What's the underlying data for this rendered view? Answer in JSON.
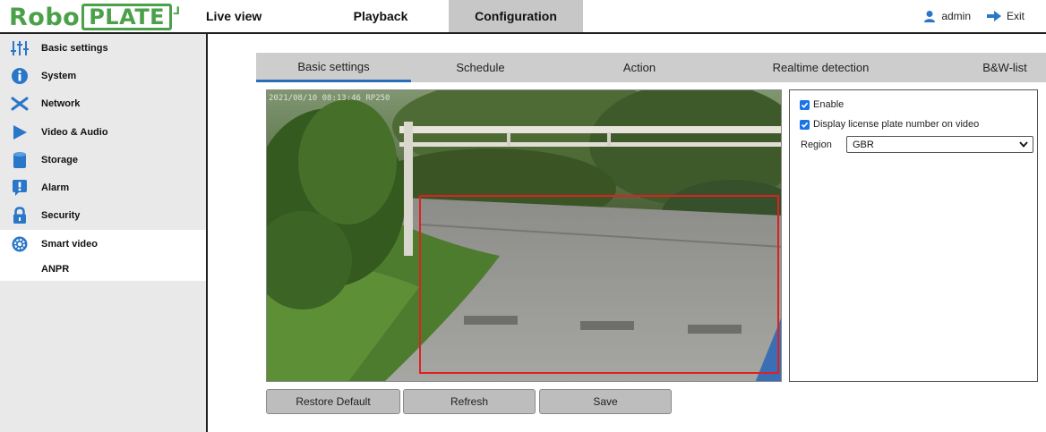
{
  "brand": {
    "robo": "Robo",
    "plate": "PLATE"
  },
  "topnav": {
    "tabs": [
      {
        "label": "Live view"
      },
      {
        "label": "Playback"
      },
      {
        "label": "Configuration"
      }
    ],
    "user": "admin",
    "exit": "Exit"
  },
  "sidebar": {
    "items": [
      {
        "label": "Basic settings",
        "icon": "sliders-icon"
      },
      {
        "label": "System",
        "icon": "info-icon"
      },
      {
        "label": "Network",
        "icon": "network-icon"
      },
      {
        "label": "Video & Audio",
        "icon": "play-icon"
      },
      {
        "label": "Storage",
        "icon": "storage-icon"
      },
      {
        "label": "Alarm",
        "icon": "alarm-icon"
      },
      {
        "label": "Security",
        "icon": "lock-icon"
      },
      {
        "label": "Smart video",
        "icon": "gear-icon"
      }
    ],
    "sub_items": [
      {
        "label": "ANPR"
      }
    ]
  },
  "subtabs": [
    {
      "label": "Basic settings"
    },
    {
      "label": "Schedule"
    },
    {
      "label": "Action"
    },
    {
      "label": "Realtime detection"
    },
    {
      "label": "B&W-list"
    }
  ],
  "video": {
    "overlay_text": "2021/08/10 08:13:46      RP250"
  },
  "settings": {
    "enable_label": "Enable",
    "enable_checked": true,
    "display_plate_label": "Display license plate number on video",
    "display_plate_checked": true,
    "region_label": "Region",
    "region_value": "GBR"
  },
  "buttons": {
    "restore_default": "Restore Default",
    "refresh": "Refresh",
    "save": "Save"
  },
  "colors": {
    "brand_green": "#4aa14a",
    "active_tab_bg": "#c7c7c7",
    "subtab_bar_bg": "#cdcdcd",
    "subtab_underline": "#2a6ebb",
    "checkbox_blue": "#1a73e8",
    "detection_box": "#e02020",
    "icon_blue": "#2a77c9"
  }
}
